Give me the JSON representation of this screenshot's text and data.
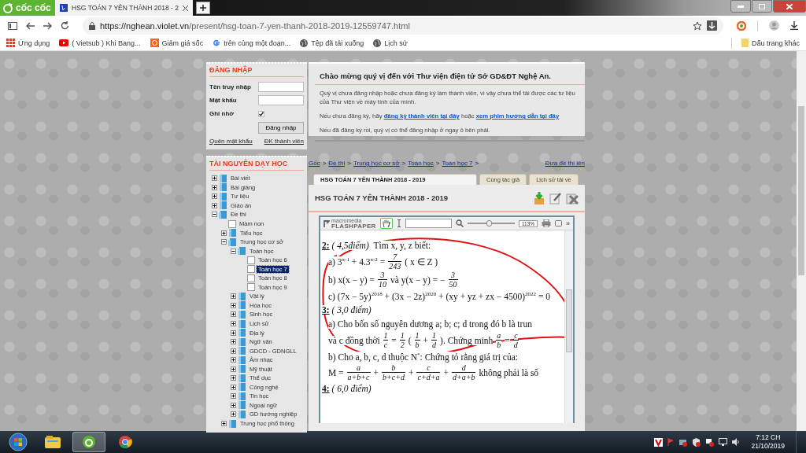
{
  "browser": {
    "logo": "cốc cốc",
    "tabs": [
      {
        "title": "HSG TOÁN 7 YÊN THÀNH 2018 - 2",
        "selected": true
      }
    ],
    "url_host": "https://nghean.violet.vn",
    "url_path": "/present/hsg-toan-7-yen-thanh-2018-2019-12559747.html",
    "bookmarks": [
      {
        "label": "Ứng dụng",
        "kind": "apps"
      },
      {
        "label": "( Vietsub ) Khi Bang...",
        "kind": "video"
      },
      {
        "label": "Giảm giá sốc",
        "kind": "shop"
      },
      {
        "label": "trên cùng một đoạn...",
        "kind": "google"
      },
      {
        "label": "Tệp đã tải xuống",
        "kind": "globe"
      },
      {
        "label": "Lịch sử",
        "kind": "globe"
      }
    ],
    "other_bookmarks": "Dấu trang khác"
  },
  "login": {
    "title": "ĐĂNG NHẬP",
    "username_label": "Tên truy nhập",
    "password_label": "Mật khẩu",
    "remember_label": "Ghi nhớ",
    "remember_checked": true,
    "submit": "Đăng nhập",
    "links": [
      "Quên mật khẩu",
      "ĐK thành viên"
    ]
  },
  "resources": {
    "title": "TÀI NGUYÊN DẠY HỌC",
    "tree": [
      {
        "label": "Bài viết",
        "kind": "folder",
        "expanded": false,
        "selected": false
      },
      {
        "label": "Bài giảng",
        "kind": "folder",
        "expanded": false,
        "selected": false
      },
      {
        "label": "Tư liệu",
        "kind": "folder",
        "expanded": false,
        "selected": false
      },
      {
        "label": "Giáo án",
        "kind": "folder",
        "expanded": false,
        "selected": false
      },
      {
        "label": "Đề thi",
        "kind": "folder",
        "expanded": true,
        "selected": false,
        "children": [
          {
            "label": "Mầm non",
            "kind": "leaf",
            "selected": false
          },
          {
            "label": "Tiểu học",
            "kind": "folder",
            "expanded": false,
            "selected": false
          },
          {
            "label": "Trung học cơ sở",
            "kind": "folder",
            "expanded": true,
            "selected": false,
            "children": [
              {
                "label": "Toán học",
                "kind": "folder",
                "expanded": true,
                "selected": false,
                "children": [
                  {
                    "label": "Toán học 6",
                    "kind": "leaf",
                    "selected": false
                  },
                  {
                    "label": "Toán học 7",
                    "kind": "leaf",
                    "selected": true
                  },
                  {
                    "label": "Toán học 8",
                    "kind": "leaf",
                    "selected": false
                  },
                  {
                    "label": "Toán học 9",
                    "kind": "leaf",
                    "selected": false
                  }
                ]
              },
              {
                "label": "Vật lý",
                "kind": "folder",
                "expanded": false,
                "selected": false
              },
              {
                "label": "Hóa học",
                "kind": "folder",
                "expanded": false,
                "selected": false
              },
              {
                "label": "Sinh học",
                "kind": "folder",
                "expanded": false,
                "selected": false
              },
              {
                "label": "Lịch sử",
                "kind": "folder",
                "expanded": false,
                "selected": false
              },
              {
                "label": "Địa lý",
                "kind": "folder",
                "expanded": false,
                "selected": false
              },
              {
                "label": "Ngữ văn",
                "kind": "folder",
                "expanded": false,
                "selected": false
              },
              {
                "label": "GDCD - GDNGLL",
                "kind": "folder",
                "expanded": false,
                "selected": false
              },
              {
                "label": "Âm nhạc",
                "kind": "folder",
                "expanded": false,
                "selected": false
              },
              {
                "label": "Mỹ thuật",
                "kind": "folder",
                "expanded": false,
                "selected": false
              },
              {
                "label": "Thể dục",
                "kind": "folder",
                "expanded": false,
                "selected": false
              },
              {
                "label": "Công nghệ",
                "kind": "folder",
                "expanded": false,
                "selected": false
              },
              {
                "label": "Tin học",
                "kind": "folder",
                "expanded": false,
                "selected": false
              },
              {
                "label": "Ngoại ngữ",
                "kind": "folder",
                "expanded": false,
                "selected": false
              },
              {
                "label": "GD hướng nghiệp",
                "kind": "folder",
                "expanded": false,
                "selected": false
              }
            ]
          },
          {
            "label": "Trung học phổ thông",
            "kind": "folder",
            "expanded": false,
            "selected": false
          }
        ]
      }
    ]
  },
  "welcome": {
    "title": "Chào mừng quý vị đến với Thư viện điện tử Sở GD&ĐT Nghệ An.",
    "paragraphs": [
      [
        {
          "text": "Quý vị chưa đăng nhập hoặc chưa đăng ký làm thành viên, vì vậy chưa thể tải được các tư liệu của Thư viện về máy tính của mình.",
          "link": false
        }
      ],
      [
        {
          "text": "Nếu chưa đăng ký, hãy ",
          "link": false
        },
        {
          "text": "đăng ký thành viên tại đây",
          "link": true
        },
        {
          "text": " hoặc ",
          "link": false
        },
        {
          "text": "xem phim hướng dẫn tại đây",
          "link": true
        }
      ],
      [
        {
          "text": "Nếu đã đăng ký rồi, quý vị có thể đăng nhập ở ngay ô bên phải.",
          "link": false
        }
      ]
    ]
  },
  "breadcrumb": {
    "items": [
      "Gốc",
      "Đề thi",
      "Trung học cơ sở",
      "Toán học",
      "Toán học 7"
    ],
    "separator": ">",
    "upload_link": "Đưa đề thi lên"
  },
  "doc_tabs": [
    {
      "label": "HSG TOÁN 7 YÊN THÀNH 2018 - 2019",
      "selected": true
    },
    {
      "label": "Cùng tác giả",
      "selected": false
    },
    {
      "label": "Lịch sử tải về",
      "selected": false
    }
  ],
  "doc_title": "HSG TOÁN 7 YÊN THÀNH 2018 - 2019",
  "viewer": {
    "brand_small": "macromedia",
    "brand": "FLASHPAPER",
    "hand_tool_selected": true,
    "zoom_slider": {
      "level": 0.45
    },
    "zoom": "113%",
    "more": "»",
    "lines": [
      {
        "kind": "heading",
        "number": "2:",
        "points": "( 4,5điểm)",
        "text": "Tìm x, y, z biết:"
      },
      {
        "kind": "math",
        "parts": [
          {
            "kind": "text",
            "text": "a) 3$^{x-1}$ + 4.3$^{x-2}$ ="
          },
          {
            "kind": "frac",
            "num": "7",
            "den": "243"
          },
          {
            "kind": "text",
            "text": "( x ∈ Z )"
          }
        ]
      },
      {
        "kind": "math",
        "parts": [
          {
            "kind": "text",
            "text": "b) x(x − y) ="
          },
          {
            "kind": "frac",
            "num": "3",
            "den": "10"
          },
          {
            "kind": "text",
            "text": "và y(x − y) = −"
          },
          {
            "kind": "frac",
            "num": "3",
            "den": "50"
          }
        ]
      },
      {
        "kind": "math",
        "parts": [
          {
            "kind": "text",
            "text": "c) (7x − 5y)$^{2018}$ + (3x − 2z)$^{2020}$ + (xy + yz + zx − 4500)$^{2022}$ = 0"
          }
        ]
      },
      {
        "kind": "heading",
        "number": "3:",
        "points": "( 3,0 điểm)"
      },
      {
        "kind": "math",
        "parts": [
          {
            "kind": "text",
            "text": "a) Cho bốn số nguyên dương  a; b; c; d trong đó b là trun"
          }
        ]
      },
      {
        "kind": "math",
        "parts": [
          {
            "kind": "text",
            "text": "và c đồng thời"
          },
          {
            "kind": "frac",
            "num": "1",
            "den": "c"
          },
          {
            "kind": "text",
            "text": "="
          },
          {
            "kind": "frac",
            "num": "1",
            "den": "2"
          },
          {
            "kind": "text",
            "text": "("
          },
          {
            "kind": "frac",
            "num": "1",
            "den": "b"
          },
          {
            "kind": "text",
            "text": "+"
          },
          {
            "kind": "frac",
            "num": "1",
            "den": "d"
          },
          {
            "kind": "text",
            "text": "). Chứng minh"
          },
          {
            "kind": "frac",
            "num": "a",
            "den": "b"
          },
          {
            "kind": "text",
            "text": "="
          },
          {
            "kind": "frac",
            "num": "c",
            "den": "d"
          }
        ]
      },
      {
        "kind": "math",
        "parts": [
          {
            "kind": "text",
            "text": "b) Cho a, b, c, d thuộc N$^{*}$: Chứng tỏ rằng giá trị của:"
          }
        ]
      },
      {
        "kind": "math",
        "parts": [
          {
            "kind": "text",
            "text": "M ="
          },
          {
            "kind": "frac",
            "num": "a",
            "den": "a+b+c"
          },
          {
            "kind": "text",
            "text": "+"
          },
          {
            "kind": "frac",
            "num": "b",
            "den": "b+c+d"
          },
          {
            "kind": "text",
            "text": "+"
          },
          {
            "kind": "frac",
            "num": "c",
            "den": "c+d+a"
          },
          {
            "kind": "text",
            "text": "+"
          },
          {
            "kind": "frac",
            "num": "d",
            "den": "d+a+b"
          },
          {
            "kind": "text",
            "text": "không phải là số"
          }
        ]
      },
      {
        "kind": "heading",
        "number": "4:",
        "points": "( 6,0 điểm)"
      }
    ]
  },
  "taskbar": {
    "apps": [
      {
        "kind": "explorer",
        "active": false
      },
      {
        "kind": "coccoc",
        "active": true
      },
      {
        "kind": "chrome",
        "active": false
      }
    ],
    "time": "7:12 CH",
    "date": "21/10/2019"
  }
}
